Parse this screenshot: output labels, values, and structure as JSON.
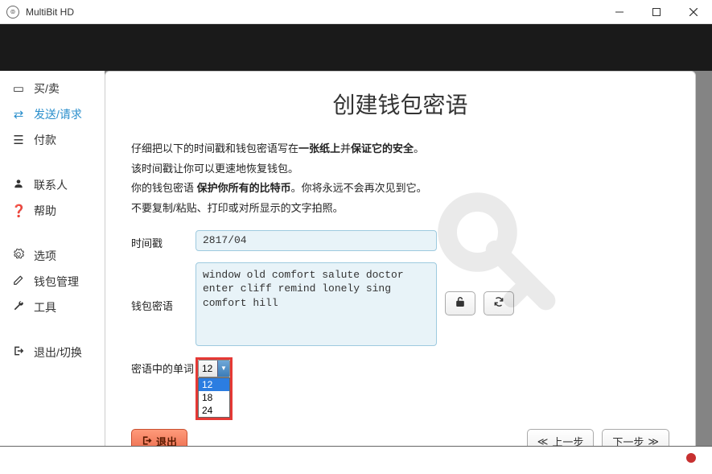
{
  "window": {
    "title": "MultiBit HD"
  },
  "sidebar": {
    "items": [
      {
        "icon": "card",
        "label": "买/卖"
      },
      {
        "icon": "transfer",
        "label": "发送/请求"
      },
      {
        "icon": "list",
        "label": "付款"
      },
      {
        "icon": "user",
        "label": "联系人"
      },
      {
        "icon": "help",
        "label": "帮助"
      },
      {
        "icon": "gear",
        "label": "选项"
      },
      {
        "icon": "edit",
        "label": "钱包管理"
      },
      {
        "icon": "wrench",
        "label": "工具"
      },
      {
        "icon": "signout",
        "label": "退出/切换"
      }
    ]
  },
  "modal": {
    "title": "创建钱包密语",
    "p1a": "仔细把以下的时间戳和钱包密语写在",
    "p1b": "一张纸上",
    "p1c": "并",
    "p1d": "保证它的安全",
    "p1e": "。",
    "p2": "该时间戳让你可以更速地恢复钱包。",
    "p3a": "你的钱包密语 ",
    "p3b": "保护你所有的比特币",
    "p3c": "。你将永远不会再次见到它。",
    "p4": "不要复制/粘贴、打印或对所显示的文字拍照。",
    "label_timestamp": "时间戳",
    "timestamp": "2817/04",
    "label_seed": "钱包密语",
    "seed": "window old comfort salute doctor enter cliff remind lonely sing comfort hill",
    "label_words": "密语中的单词",
    "words_selected": "12",
    "options": [
      "12",
      "18",
      "24"
    ],
    "btn_exit": "退出",
    "btn_prev": "上一步",
    "btn_next": "下一步"
  }
}
